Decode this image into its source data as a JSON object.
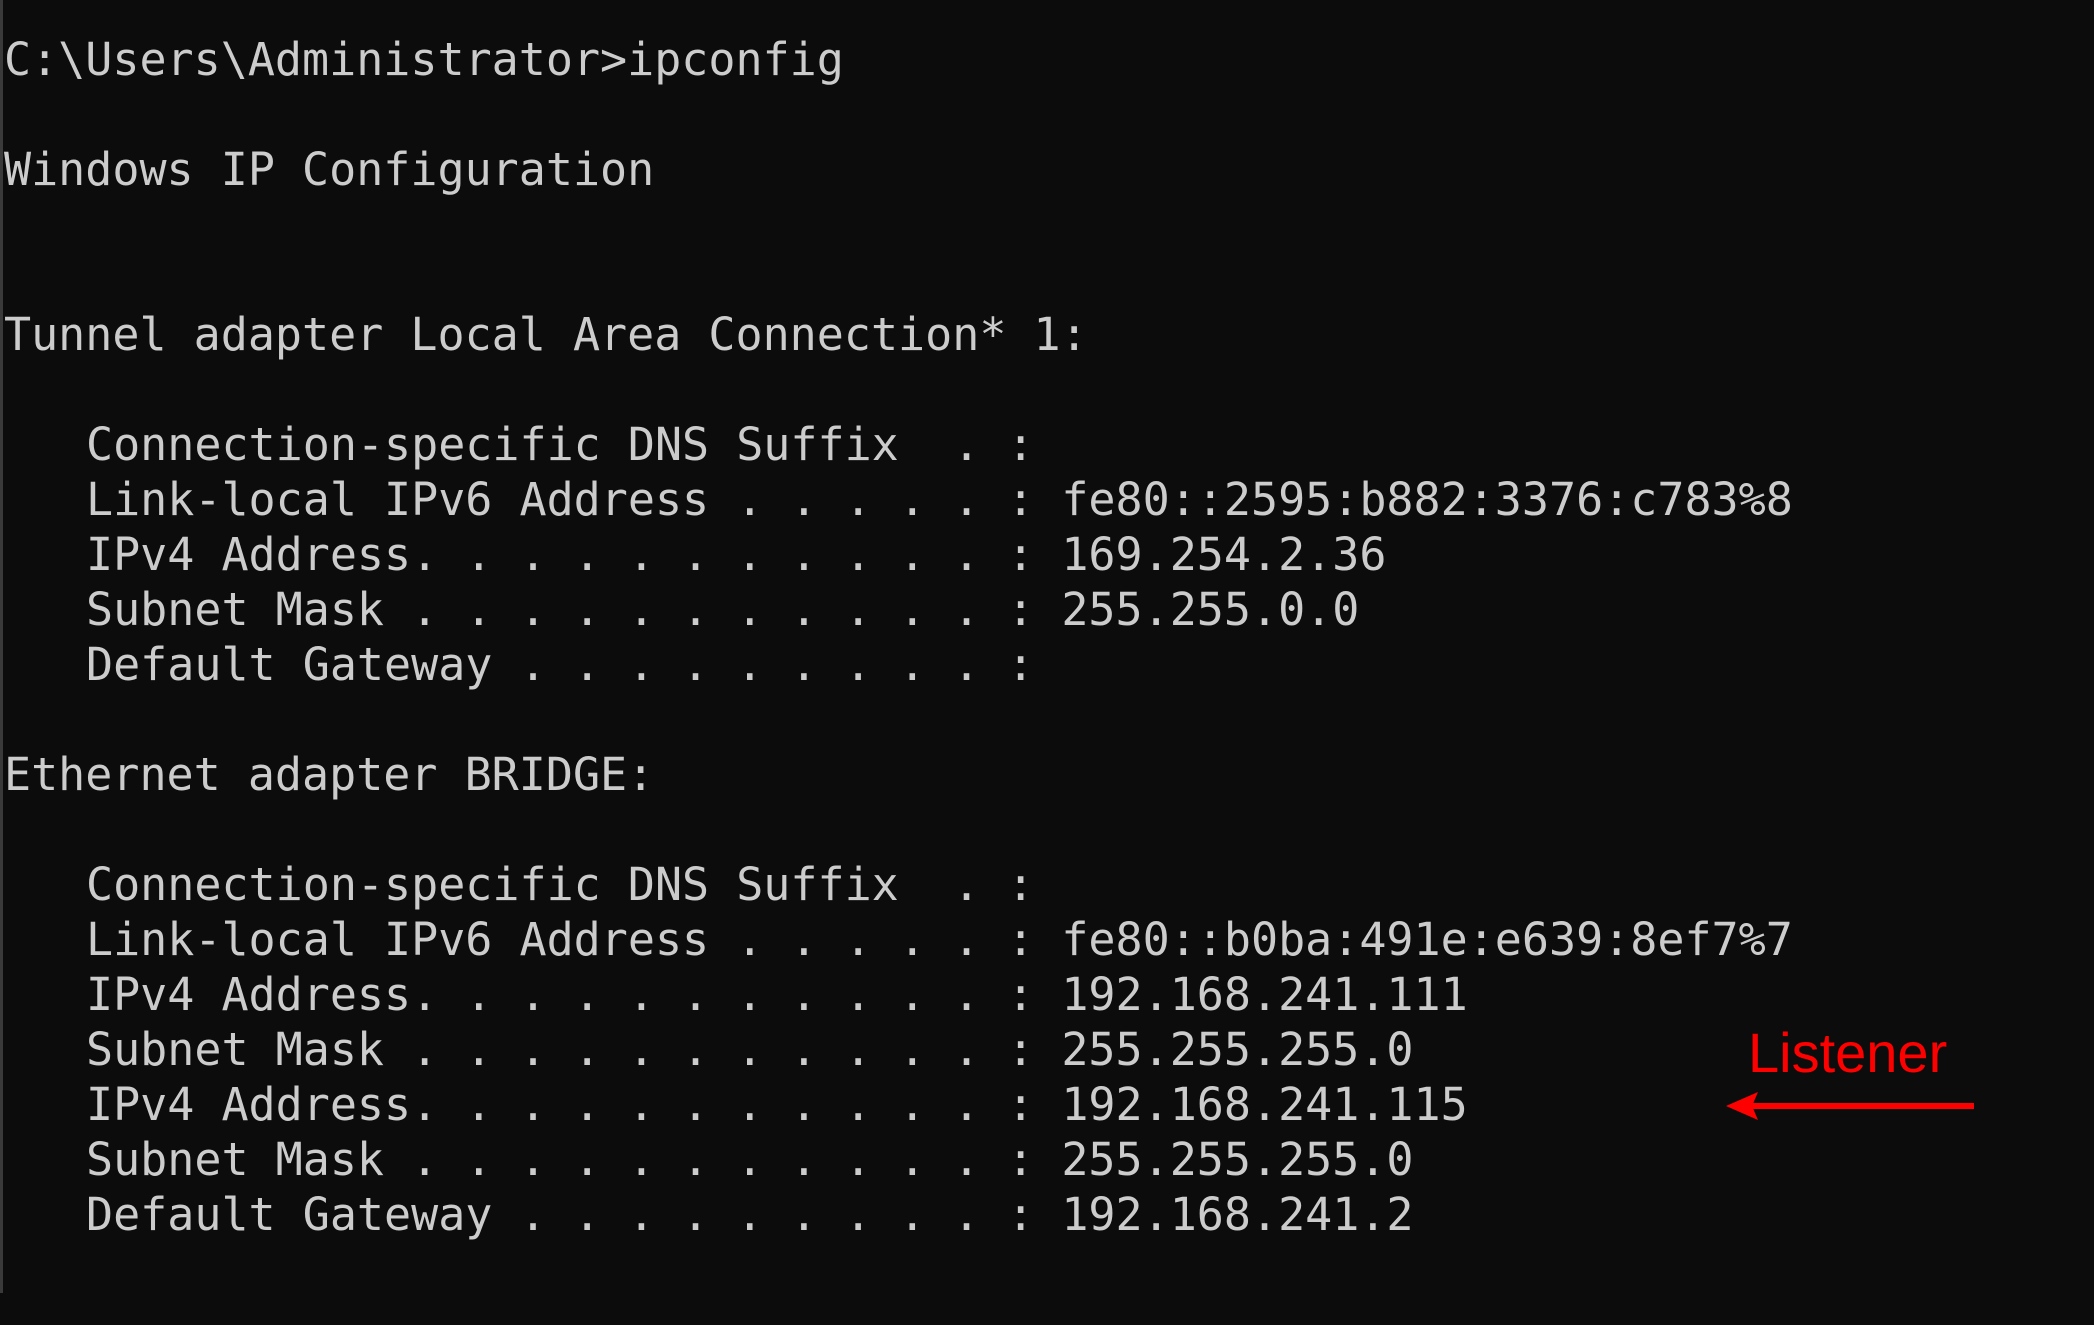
{
  "window": {
    "title": ""
  },
  "console": {
    "prompt_line": "C:\\Users\\Administrator>ipconfig",
    "header": "Windows IP Configuration",
    "adapters": [
      {
        "heading": "Tunnel adapter Local Area Connection* 1:",
        "rows": [
          {
            "label": "Connection-specific DNS Suffix  . :",
            "value": ""
          },
          {
            "label": "Link-local IPv6 Address . . . . . :",
            "value": "fe80::2595:b882:3376:c783%8"
          },
          {
            "label": "IPv4 Address. . . . . . . . . . . :",
            "value": "169.254.2.36"
          },
          {
            "label": "Subnet Mask . . . . . . . . . . . :",
            "value": "255.255.0.0"
          },
          {
            "label": "Default Gateway . . . . . . . . . :",
            "value": ""
          }
        ]
      },
      {
        "heading": "Ethernet adapter BRIDGE:",
        "rows": [
          {
            "label": "Connection-specific DNS Suffix  . :",
            "value": ""
          },
          {
            "label": "Link-local IPv6 Address . . . . . :",
            "value": "fe80::b0ba:491e:e639:8ef7%7"
          },
          {
            "label": "IPv4 Address. . . . . . . . . . . :",
            "value": "192.168.241.111"
          },
          {
            "label": "Subnet Mask . . . . . . . . . . . :",
            "value": "255.255.255.0"
          },
          {
            "label": "IPv4 Address. . . . . . . . . . . :",
            "value": "192.168.241.115"
          },
          {
            "label": "Subnet Mask . . . . . . . . . . . :",
            "value": "255.255.255.0"
          },
          {
            "label": "Default Gateway . . . . . . . . . :",
            "value": "192.168.241.2"
          }
        ]
      }
    ]
  },
  "annotation": {
    "label": "Listener",
    "color": "#ff0000",
    "icon": "left-arrow-icon"
  },
  "colors": {
    "background": "#0c0c0c",
    "text": "#cccccc",
    "annotation": "#ff0000"
  }
}
